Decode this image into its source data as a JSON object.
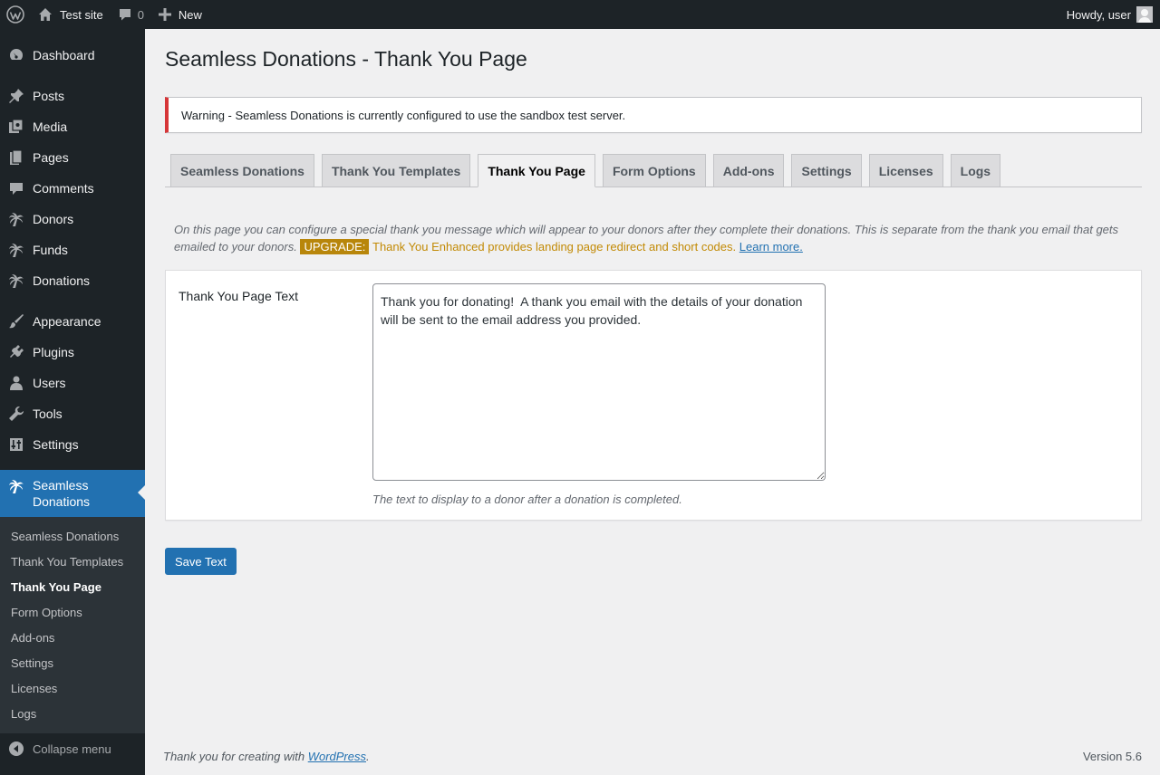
{
  "adminbar": {
    "wp_logo_icon": "wordpress-logo-icon",
    "site_name": "Test site",
    "comments_count": "0",
    "new_label": "New",
    "howdy": "Howdy, user"
  },
  "sidebar": {
    "items": [
      {
        "label": "Dashboard",
        "icon": "dashboard-icon"
      },
      {
        "label": "Posts",
        "icon": "pin-icon"
      },
      {
        "label": "Media",
        "icon": "media-icon"
      },
      {
        "label": "Pages",
        "icon": "pages-icon"
      },
      {
        "label": "Comments",
        "icon": "comment-icon"
      },
      {
        "label": "Donors",
        "icon": "palm-tree-icon"
      },
      {
        "label": "Funds",
        "icon": "palm-tree-icon"
      },
      {
        "label": "Donations",
        "icon": "palm-tree-icon"
      },
      {
        "label": "Appearance",
        "icon": "brush-icon"
      },
      {
        "label": "Plugins",
        "icon": "plug-icon"
      },
      {
        "label": "Users",
        "icon": "user-icon"
      },
      {
        "label": "Tools",
        "icon": "wrench-icon"
      },
      {
        "label": "Settings",
        "icon": "sliders-icon"
      },
      {
        "label": "Seamless Donations",
        "icon": "palm-tree-icon"
      }
    ],
    "submenu": [
      "Seamless Donations",
      "Thank You Templates",
      "Thank You Page",
      "Form Options",
      "Add-ons",
      "Settings",
      "Licenses",
      "Logs"
    ],
    "collapse_label": "Collapse menu"
  },
  "page": {
    "title": "Seamless Donations - Thank You Page",
    "notice": "Warning - Seamless Donations is currently configured to use the sandbox test server.",
    "tabs": [
      "Seamless Donations",
      "Thank You Templates",
      "Thank You Page",
      "Form Options",
      "Add-ons",
      "Settings",
      "Licenses",
      "Logs"
    ],
    "active_tab": "Thank You Page",
    "intro_text": "On this page you can configure a special thank you message which will appear to your donors after they complete their donations. This is separate from the thank you email that gets emailed to your donors.",
    "upgrade_badge": "UPGRADE:",
    "upgrade_text": "Thank You Enhanced provides landing page redirect and short codes.",
    "learn_more": "Learn more.",
    "field_label": "Thank You Page Text",
    "field_value": "Thank you for donating!  A thank you email with the details of your donation will be sent to the email address you provided.",
    "field_description": "The text to display to a donor after a donation is completed.",
    "save_label": "Save Text"
  },
  "footer": {
    "credit_prefix": "Thank you for creating with",
    "credit_link": "WordPress",
    "credit_suffix": ".",
    "version": "Version 5.6"
  },
  "colors": {
    "adminbar_bg": "#1d2327",
    "menu_current": "#2271b1",
    "notice_border": "#d63638",
    "upgrade_badge": "#b8860b",
    "upgrade_text": "#c28a05"
  }
}
